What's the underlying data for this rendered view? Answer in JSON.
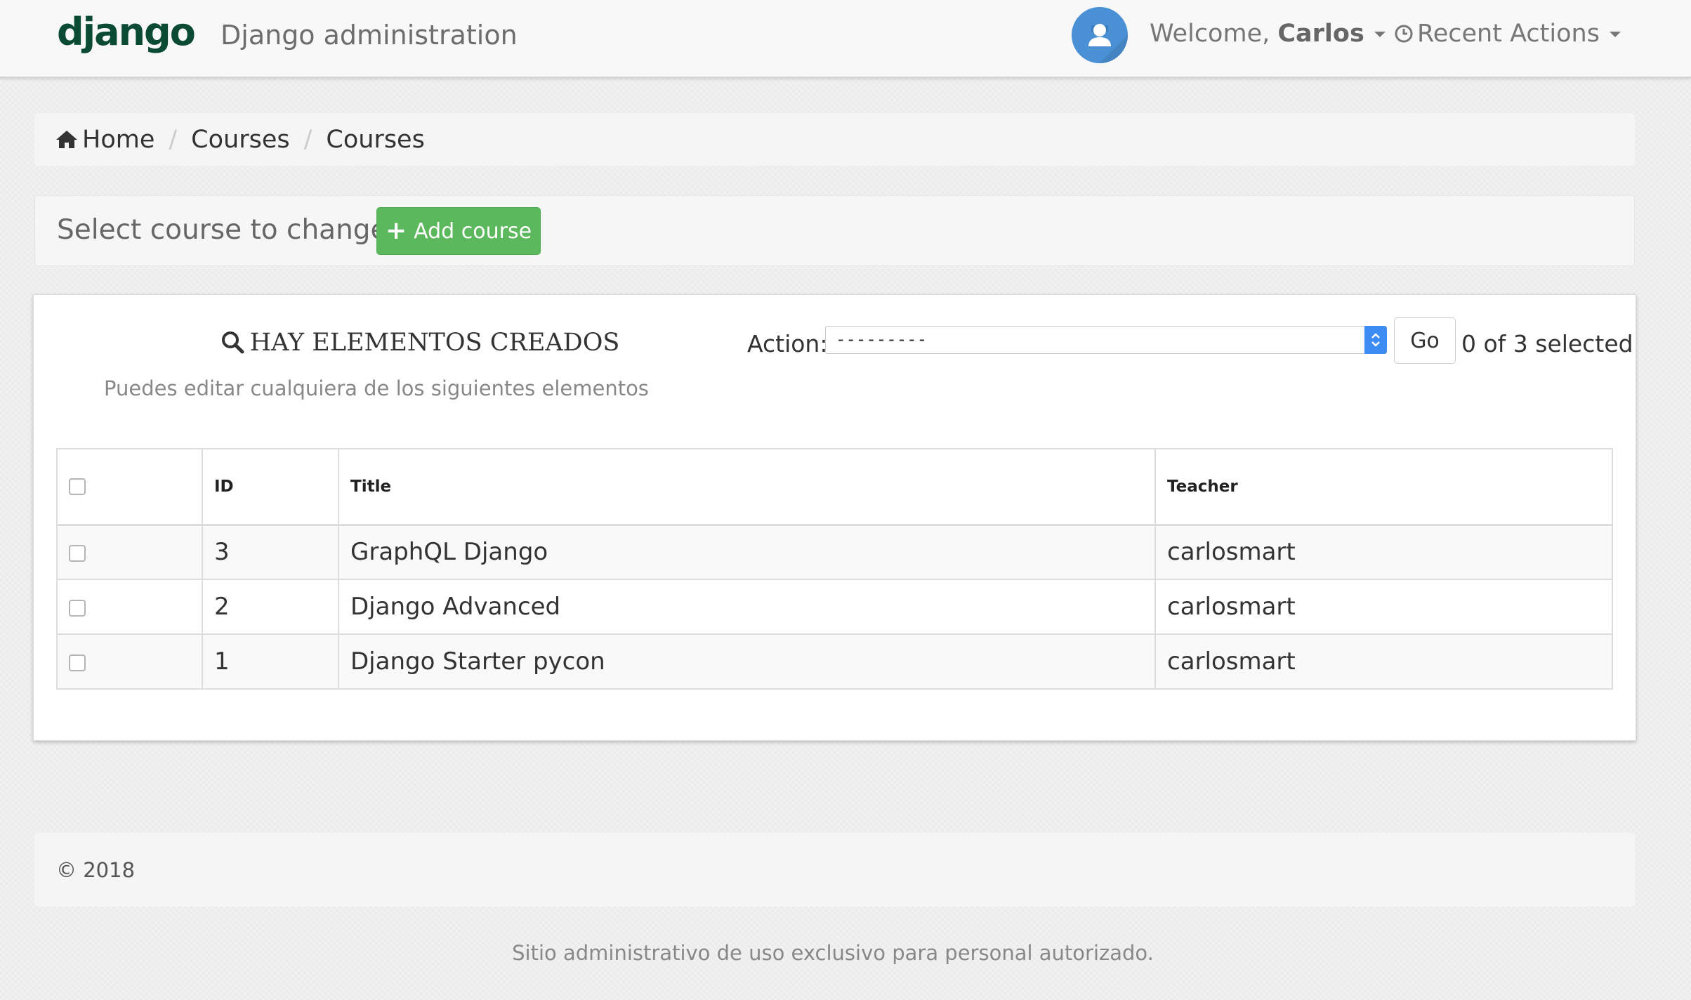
{
  "navbar": {
    "brand": "django",
    "site_title": "Django administration",
    "welcome_prefix": "Welcome, ",
    "user_name": "Carlos",
    "recent_actions": "Recent Actions"
  },
  "breadcrumb": {
    "items": [
      "Home",
      "Courses",
      "Courses"
    ],
    "separator": "/"
  },
  "page": {
    "title": "Select course to change",
    "add_button": "Add course"
  },
  "changelist": {
    "heading": "HAY ELEMENTOS CREADOS",
    "subheading": "Puedes editar cualquiera de los siguientes elementos",
    "action_label": "Action:",
    "action_selected": "---------",
    "go_button": "Go",
    "selection_count": "0 of 3 selected",
    "columns": [
      "ID",
      "Title",
      "Teacher"
    ],
    "rows": [
      {
        "id": "3",
        "title": "GraphQL Django",
        "teacher": "carlosmart"
      },
      {
        "id": "2",
        "title": "Django Advanced",
        "teacher": "carlosmart"
      },
      {
        "id": "1",
        "title": "Django Starter pycon",
        "teacher": "carlosmart"
      }
    ]
  },
  "footer": {
    "copyright": "© 2018",
    "note": "Sitio administrativo de uso exclusivo para personal autorizado."
  },
  "colors": {
    "brand": "#0c4b33",
    "add_button": "#5cb85c",
    "avatar": "#4a90d4",
    "select_arrows": "#3d8cf4"
  },
  "icons": {
    "breadcrumb_home": "home-icon",
    "heading": "search-icon",
    "recent_actions": "clock-icon",
    "add_button": "plus-icon",
    "avatar": "user-icon",
    "dropdown": "caret-down-icon"
  }
}
